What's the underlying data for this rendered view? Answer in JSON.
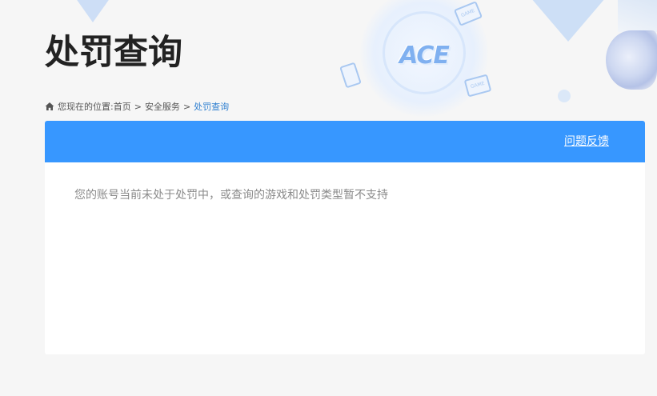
{
  "header": {
    "title": "处罚查询",
    "logo_text": "ACE",
    "game_badge_text": "GAME"
  },
  "breadcrumb": {
    "prefix": "您现在的位置:",
    "items": [
      {
        "label": "首页"
      },
      {
        "label": "安全服务"
      },
      {
        "label": "处罚查询"
      }
    ],
    "separator": ">"
  },
  "panel": {
    "feedback_label": "问题反馈",
    "message": "您的账号当前未处于处罚中，或查询的游戏和处罚类型暂不支持"
  },
  "colors": {
    "header_bar": "#3797ff",
    "breadcrumb_active": "#2f7fd0",
    "message_text": "#8a8a8a",
    "background": "#f6f6f6"
  }
}
